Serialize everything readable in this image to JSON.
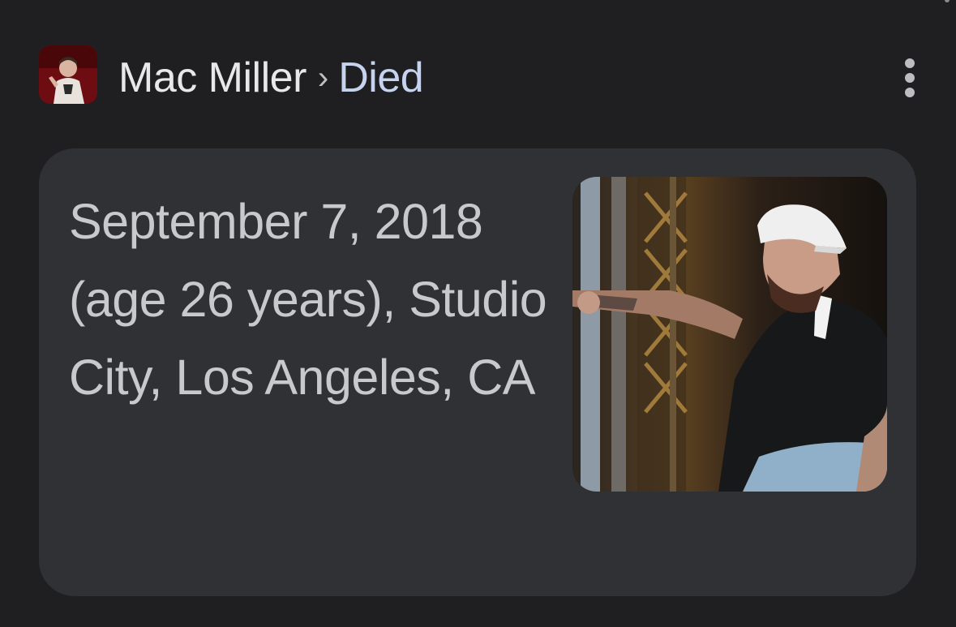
{
  "header": {
    "entity": "Mac Miller",
    "separator": "›",
    "attribute": "Died",
    "avatar_icon": "person-portrait-icon",
    "more_icon": "more-vert-icon"
  },
  "answer": {
    "text": "September 7, 2018 (age 26 years), Studio City, Los Angeles, CA",
    "image_icon": "performer-photo"
  },
  "colors": {
    "background": "#1f1f21",
    "card": "#303134",
    "entity_text": "#e8e8ea",
    "attribute_text": "#c6d3ee",
    "answer_text": "#c9c9cc"
  }
}
